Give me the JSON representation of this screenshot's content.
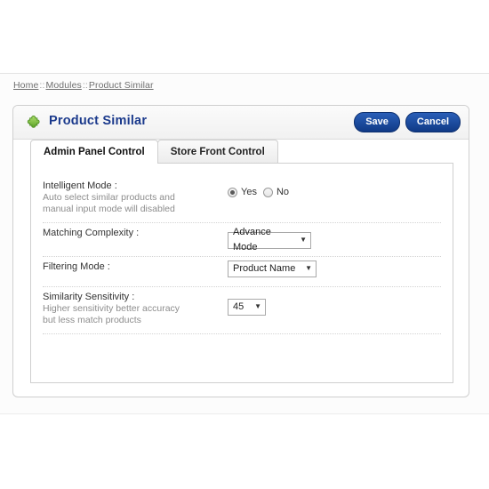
{
  "breadcrumb": {
    "items": [
      {
        "label": "Home",
        "link": true
      },
      {
        "label": "Modules",
        "link": true
      },
      {
        "label": "Product Similar",
        "link": true
      }
    ],
    "separator": "::"
  },
  "panel": {
    "title": "Product Similar",
    "icon": "puzzle-piece-icon",
    "title_color": "#1b3a8c",
    "buttons": {
      "save": "Save",
      "cancel": "Cancel",
      "color": "#12408d"
    }
  },
  "tabs": [
    {
      "label": "Admin Panel Control",
      "active": true
    },
    {
      "label": "Store Front Control",
      "active": false
    }
  ],
  "form": {
    "rows": [
      {
        "label": "Intelligent Mode :",
        "sub_lines": [
          "Auto select similar products and",
          "manual input mode will disabled"
        ],
        "field_type": "radio",
        "options": [
          {
            "label": "Yes",
            "selected": true
          },
          {
            "label": "No",
            "selected": false
          }
        ]
      },
      {
        "label": "Matching Complexity :",
        "sub_lines": [],
        "field_type": "select",
        "value": "Advance Mode",
        "width": "wide"
      },
      {
        "label": "Filtering Mode :",
        "sub_lines": [],
        "field_type": "select",
        "value": "Product Name",
        "width": "medium"
      },
      {
        "label": "Similarity Sensitivity :",
        "sub_lines": [
          "Higher sensitivity better accuracy",
          "but less match products"
        ],
        "field_type": "select",
        "value": "45",
        "width": "narrow"
      }
    ]
  }
}
